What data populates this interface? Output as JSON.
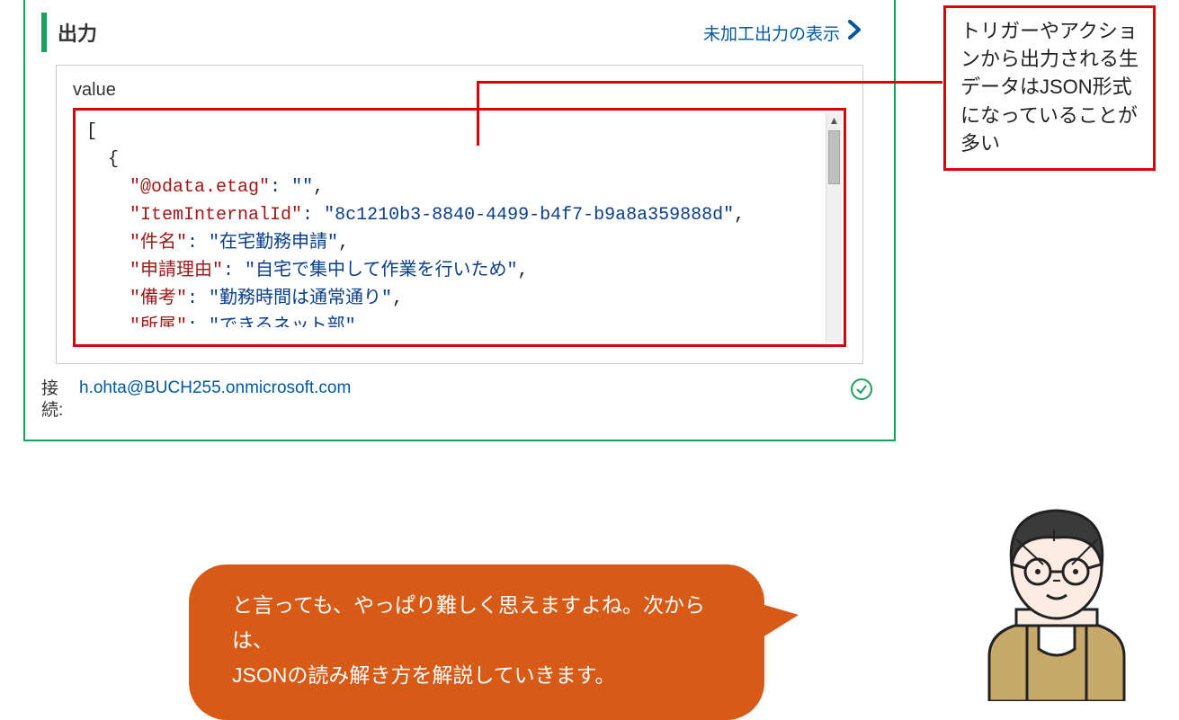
{
  "panel": {
    "output_title": "出力",
    "raw_link": "未加工出力の表示",
    "value_label": "value",
    "json_lines": [
      {
        "indent": 0,
        "type": "bracket",
        "text": "["
      },
      {
        "indent": 1,
        "type": "bracket",
        "text": "{"
      },
      {
        "indent": 2,
        "type": "kv",
        "key": "\"@odata.etag\"",
        "value": "\"\"",
        "trailing": ","
      },
      {
        "indent": 2,
        "type": "kv",
        "key": "\"ItemInternalId\"",
        "value": "\"8c1210b3-8840-4499-b4f7-b9a8a359888d\"",
        "trailing": ","
      },
      {
        "indent": 2,
        "type": "kv",
        "key": "\"件名\"",
        "value": "\"在宅勤務申請\"",
        "trailing": ","
      },
      {
        "indent": 2,
        "type": "kv",
        "key": "\"申請理由\"",
        "value": "\"自宅で集中して作業を行いため\"",
        "trailing": ","
      },
      {
        "indent": 2,
        "type": "kv",
        "key": "\"備考\"",
        "value": "\"勤務時間は通常通り\"",
        "trailing": ","
      },
      {
        "indent": 2,
        "type": "kv_cut",
        "key": "\"所属\"",
        "value": "\"できるネット部\"",
        "trailing": ""
      }
    ],
    "connection_label": "接続:",
    "connection_email": "h.ohta@BUCH255.onmicrosoft.com"
  },
  "callout": {
    "text": "トリガーやアクションから出力される生データはJSON形式になっていることが多い"
  },
  "speech": {
    "line1": "と言っても、やっぱり難しく思えますよね。次からは、",
    "line2": "JSONの読み解き方を解説していきます。"
  }
}
